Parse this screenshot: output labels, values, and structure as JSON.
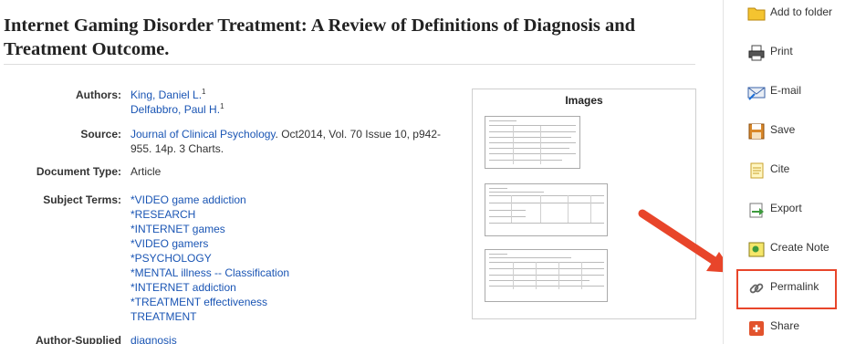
{
  "article": {
    "title_pre": "Internet ",
    "title_bold": "Gaming",
    "title_post": " Disorder Treatment: A Review of Definitions of Diagnosis and Treatment Outcome."
  },
  "fields": {
    "authors_label": "Authors:",
    "authors": [
      {
        "name": "King, Daniel L.",
        "sup": "1"
      },
      {
        "name": "Delfabbro, Paul H.",
        "sup": "1"
      }
    ],
    "source_label": "Source:",
    "source_journal": "Journal of Clinical Psychology",
    "source_rest_1": ". Oct2014, Vol. 70 Issue 10, p942-",
    "source_rest_2": "955. 14p. 3 Charts.",
    "doctype_label": "Document Type:",
    "doctype_value": "Article",
    "subject_label": "Subject Terms:",
    "subjects": [
      "*VIDEO game addiction",
      "*RESEARCH",
      "*INTERNET games",
      "*VIDEO gamers",
      "*PSYCHOLOGY",
      "*MENTAL illness -- Classification",
      "*INTERNET addiction",
      "*TREATMENT effectiveness",
      "TREATMENT"
    ],
    "author_supplied_label": "Author-Supplied",
    "author_supplied_first": "diagnosis"
  },
  "images": {
    "title": "Images"
  },
  "tools": [
    {
      "label": "Add to folder",
      "icon": "folder-icon"
    },
    {
      "label": "Print",
      "icon": "printer-icon"
    },
    {
      "label": "E-mail",
      "icon": "email-icon"
    },
    {
      "label": "Save",
      "icon": "save-disk-icon"
    },
    {
      "label": "Cite",
      "icon": "cite-document-icon"
    },
    {
      "label": "Export",
      "icon": "export-icon"
    },
    {
      "label": "Create Note",
      "icon": "note-icon"
    },
    {
      "label": "Permalink",
      "icon": "link-chain-icon"
    },
    {
      "label": "Share",
      "icon": "share-plus-icon"
    }
  ],
  "colors": {
    "link": "#1a55b4",
    "highlight": "#e8452a"
  }
}
